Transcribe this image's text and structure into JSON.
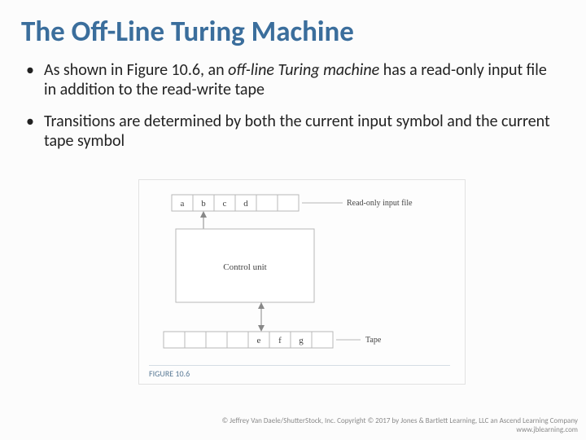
{
  "title": "The Off-Line Turing Machine",
  "bullets": {
    "b1a": "As shown in Figure 10.6, an ",
    "b1b": "off-line Turing machine",
    "b1c": " has a read-only input file in addition to the read-write tape",
    "b2": "Transitions are determined by both the current input symbol and the current tape symbol"
  },
  "figure": {
    "cells_top": [
      "a",
      "b",
      "c",
      "d"
    ],
    "cells_bot": [
      "e",
      "f",
      "g"
    ],
    "label_top": "Read-only input file",
    "label_mid": "Control unit",
    "label_bot": "Tape",
    "caption": "FIGURE 10.6"
  },
  "copyright": {
    "line1": "© Jeffrey Van Daele/ShutterStock, Inc. Copyright © 2017 by Jones & Bartlett Learning, LLC an Ascend Learning Company",
    "line2": "www.jblearning.com"
  }
}
